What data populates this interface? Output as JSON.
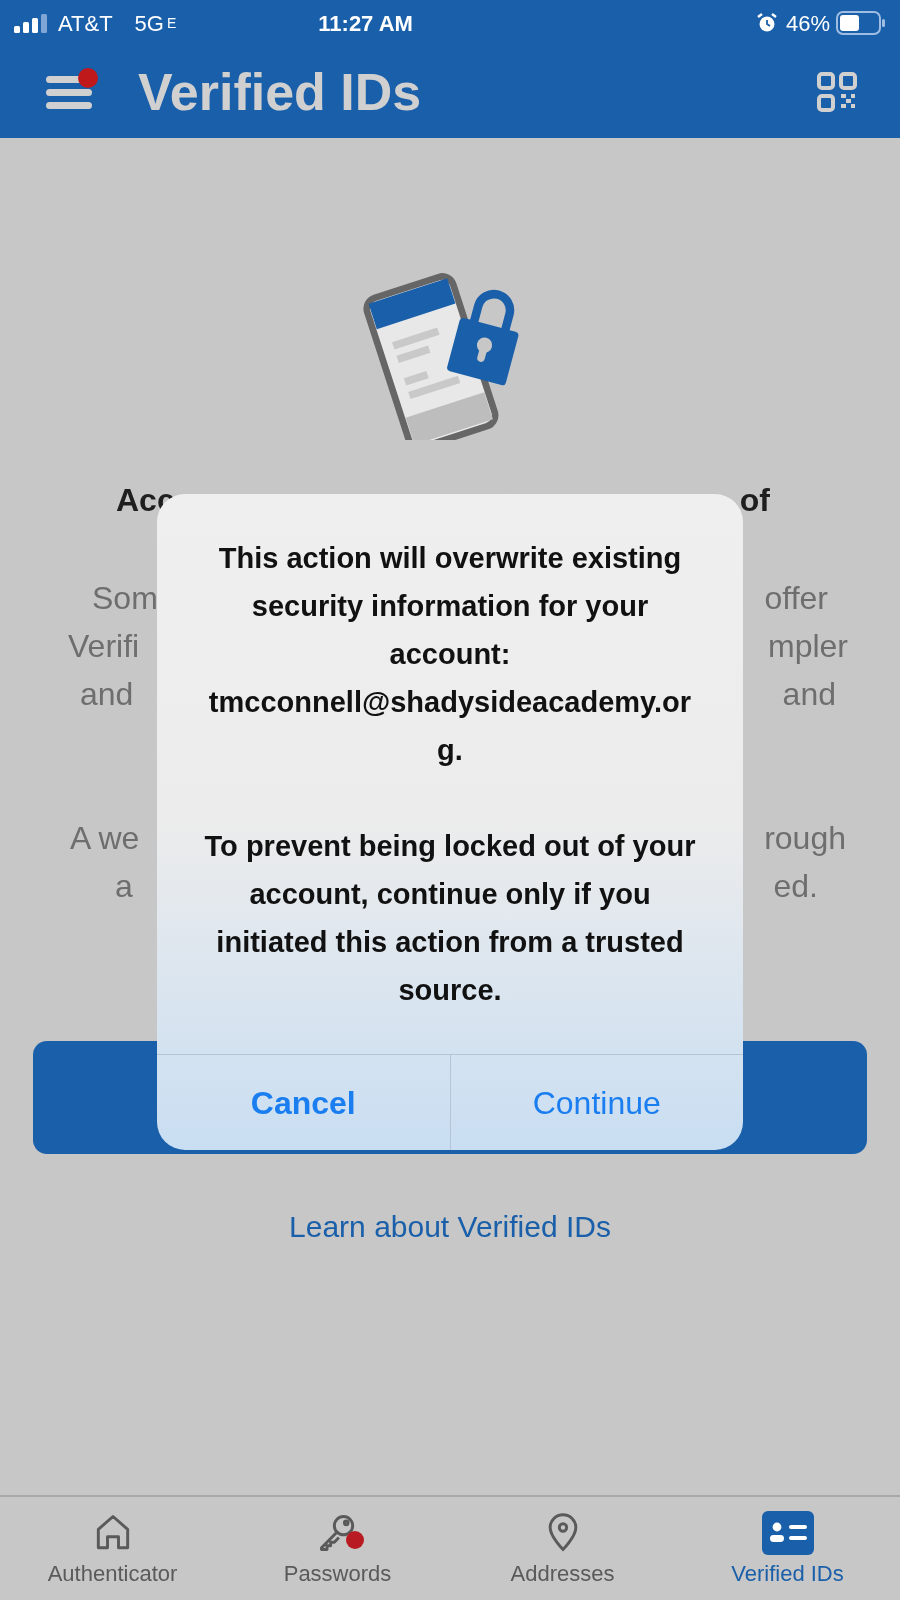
{
  "status_bar": {
    "carrier": "AT&T",
    "network": "5G",
    "network_suffix": "E",
    "time": "11:27 AM",
    "battery": "46%"
  },
  "header": {
    "title": "Verified IDs",
    "menu_badge": true
  },
  "background": {
    "title": {
      "left": "Acc",
      "right": "of"
    },
    "lines": [
      {
        "left": "Som",
        "right": "offer"
      },
      {
        "left": "Verifi",
        "right": "mpler"
      },
      {
        "left": "and",
        "right": "and"
      },
      {
        "left": "A we",
        "right": "rough"
      },
      {
        "left": "a",
        "right": "ed."
      }
    ],
    "link": "Learn about Verified IDs"
  },
  "dialog": {
    "message": "This action will overwrite existing security information for your account: tmcconnell@shadysideacademy.org.",
    "warning": "To prevent being locked out of your account, continue only if you initiated this action from a trusted source.",
    "buttons": [
      {
        "label": "Cancel",
        "bold": true
      },
      {
        "label": "Continue",
        "bold": false
      }
    ]
  },
  "tabs": [
    {
      "label": "Authenticator",
      "kind": "home",
      "selected": false,
      "badge": false
    },
    {
      "label": "Passwords",
      "kind": "key",
      "selected": false,
      "badge": true
    },
    {
      "label": "Addresses",
      "kind": "pin",
      "selected": false,
      "badge": false
    },
    {
      "label": "Verified IDs",
      "kind": "card",
      "selected": true,
      "badge": false
    }
  ]
}
